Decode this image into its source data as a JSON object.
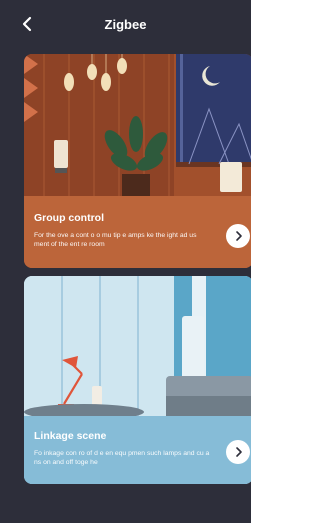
{
  "header": {
    "title": "Zigbee",
    "back_icon": "chevron-left-icon"
  },
  "cards": [
    {
      "title": "Group control",
      "description": "For the ove a  cont o  o  mu tip e  amps  ke the  ight ad us ment of the ent re room",
      "action_icon": "chevron-right-icon"
    },
    {
      "title": "Linkage scene",
      "description": "Fo   inkage con ro  of d  e en  equ pmen  such lamps and cu  a ns on and off toge he",
      "action_icon": "chevron-right-icon"
    }
  ],
  "colors": {
    "background": "#2d2e3a",
    "card1_accent": "#c0663a",
    "card2_accent": "#8fc3dd",
    "lamp_red": "#e0553a"
  }
}
